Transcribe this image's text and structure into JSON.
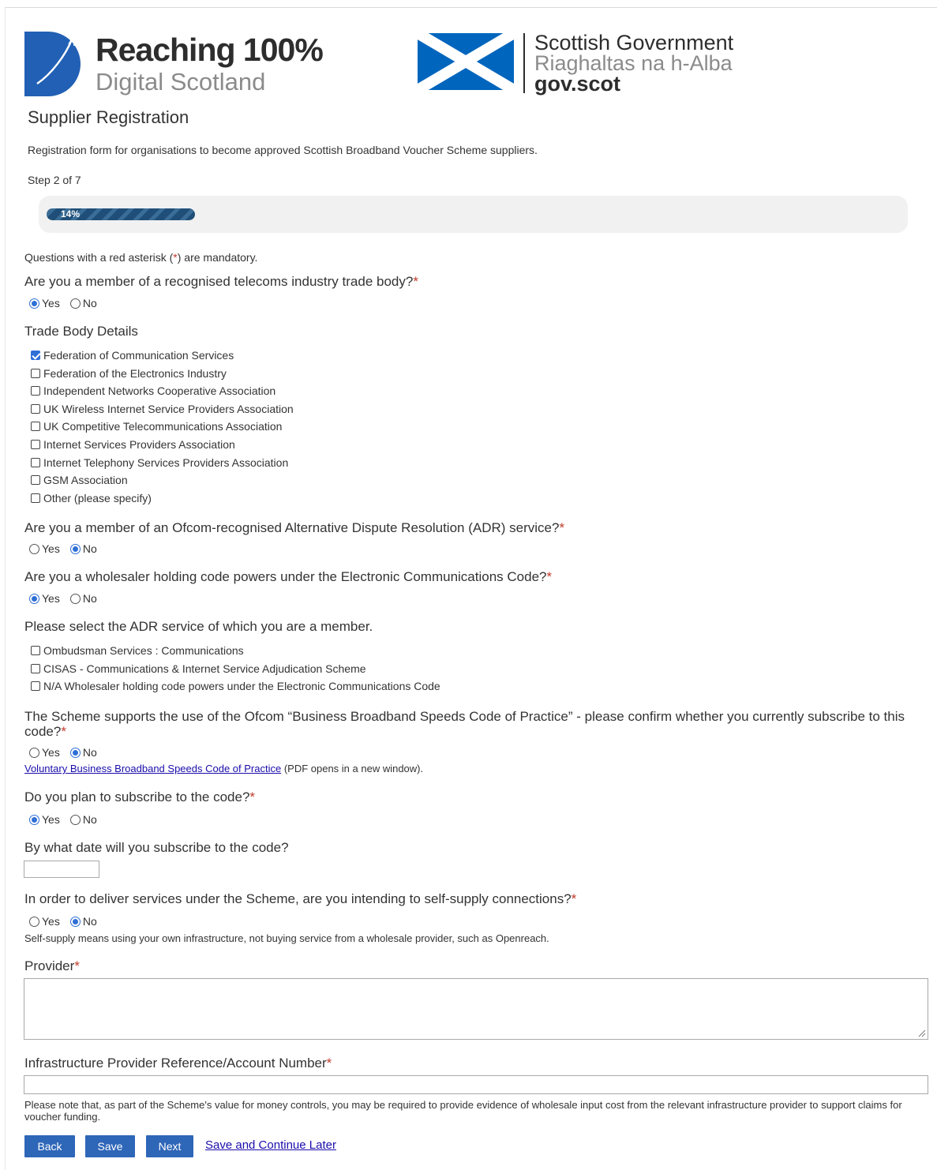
{
  "header": {
    "r100": {
      "title": "Reaching 100%",
      "subtitle": "Digital Scotland"
    },
    "sg": {
      "line1": "Scottish Government",
      "line2": "Riaghaltas na h-Alba",
      "line3": "gov.scot"
    }
  },
  "page": {
    "title": "Supplier Registration",
    "intro": "Registration form for organisations to become approved Scottish Broadband Voucher Scheme suppliers.",
    "step": "Step 2 of 7",
    "progress": {
      "percent": 14,
      "label": "14%"
    },
    "mandatory_note_pre": "Questions with a red asterisk (",
    "mandatory_note_star": "*",
    "mandatory_note_post": ") are mandatory."
  },
  "colors": {
    "accent": "#2e66b8",
    "required": "#c0392b",
    "link": "#1a0dab",
    "progress": "#1f4f78",
    "r100_blue": "#2160b4",
    "saltire_blue": "#0065bd"
  },
  "asterisk": "*",
  "q1": {
    "text": "Are you a member of a recognised telecoms industry trade body?",
    "options": [
      "Yes",
      "No"
    ],
    "selected": "Yes"
  },
  "trade_body": {
    "heading": "Trade Body Details",
    "items": [
      {
        "label": "Federation of Communication Services",
        "checked": true
      },
      {
        "label": "Federation of the Electronics Industry",
        "checked": false
      },
      {
        "label": "Independent Networks Cooperative Association",
        "checked": false
      },
      {
        "label": "UK Wireless Internet Service Providers Association",
        "checked": false
      },
      {
        "label": "UK Competitive Telecommunications Association",
        "checked": false
      },
      {
        "label": "Internet Services Providers Association",
        "checked": false
      },
      {
        "label": "Internet Telephony Services Providers Association",
        "checked": false
      },
      {
        "label": "GSM Association",
        "checked": false
      },
      {
        "label": "Other (please specify)",
        "checked": false
      }
    ]
  },
  "q2": {
    "text": "Are you a member of an Ofcom-recognised Alternative Dispute Resolution (ADR) service?",
    "options": [
      "Yes",
      "No"
    ],
    "selected": "No"
  },
  "q3": {
    "text": "Are you a wholesaler holding code powers under the Electronic Communications Code?",
    "options": [
      "Yes",
      "No"
    ],
    "selected": "Yes"
  },
  "adr": {
    "heading": "Please select the ADR service of which you are a member.",
    "items": [
      {
        "label": "Ombudsman Services : Communications",
        "checked": false
      },
      {
        "label": "CISAS - Communications & Internet Service Adjudication Scheme",
        "checked": false
      },
      {
        "label": "N/A Wholesaler holding code powers under the Electronic Communications Code",
        "checked": false
      }
    ]
  },
  "q4": {
    "text": "The Scheme supports the use of the Ofcom “Business Broadband Speeds Code of Practice” - please confirm whether you currently subscribe to this code?",
    "options": [
      "Yes",
      "No"
    ],
    "selected": "No",
    "link_text": "Voluntary Business Broadband Speeds Code of Practice",
    "link_note": " (PDF opens in a new window)."
  },
  "q5": {
    "text": "Do you plan to subscribe to the code?",
    "options": [
      "Yes",
      "No"
    ],
    "selected": "Yes"
  },
  "q6": {
    "text": "By what date will you subscribe to the code?",
    "value": ""
  },
  "q7": {
    "text": "In order to deliver services under the Scheme, are you intending to self-supply connections?",
    "options": [
      "Yes",
      "No"
    ],
    "selected": "No",
    "help": "Self-supply means using your own infrastructure, not buying service from a wholesale provider, such as Openreach."
  },
  "provider": {
    "label": "Provider",
    "value": ""
  },
  "infra": {
    "label": "Infrastructure Provider Reference/Account Number",
    "value": "",
    "note": "Please note that, as part of the Scheme's value for money controls, you may be required to provide evidence of wholesale input cost from the relevant infrastructure provider to support claims for voucher funding."
  },
  "actions": {
    "back": "Back",
    "save": "Save",
    "next": "Next",
    "save_later": "Save and Continue Later"
  }
}
